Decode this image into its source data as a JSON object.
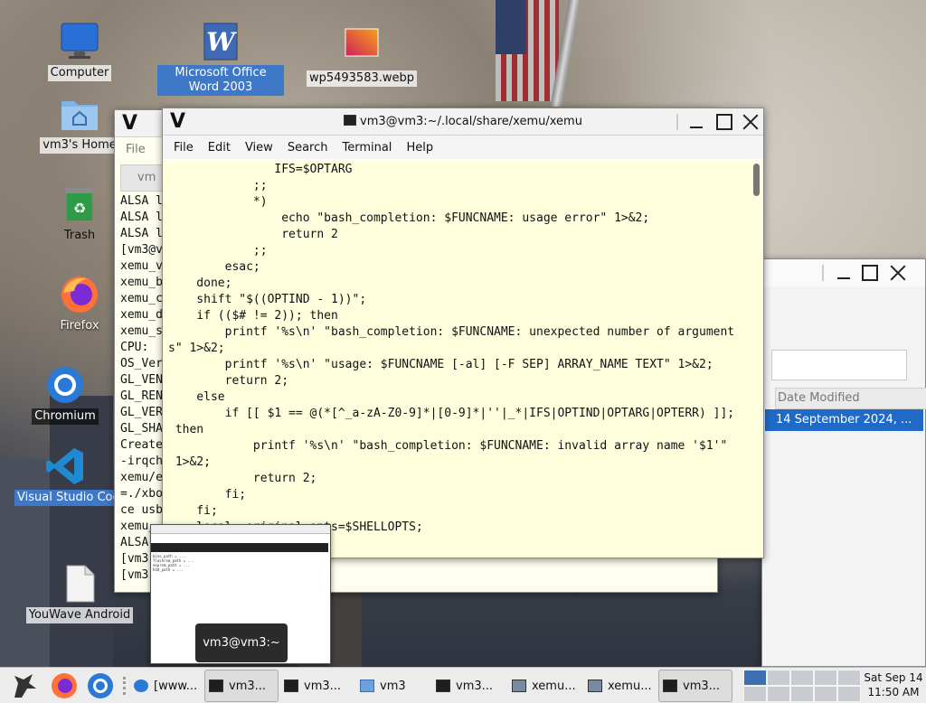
{
  "desktop_icons": {
    "computer": "Computer",
    "msword": "Microsoft Office Word 2003",
    "webp": "wp5493583.webp",
    "home": "vm3's Home",
    "trash": "Trash",
    "firefox": "Firefox",
    "chromium": "Chromium",
    "vscode": "Visual Studio Code",
    "youwave": "YouWave Android"
  },
  "terminal": {
    "title": "vm3@vm3:~/.local/share/xemu/xemu",
    "menu": [
      "File",
      "Edit",
      "View",
      "Search",
      "Terminal",
      "Help"
    ],
    "content": "               IFS=$OPTARG\n            ;;\n            *)\n                echo \"bash_completion: $FUNCNAME: usage error\" 1>&2;\n                return 2\n            ;;\n        esac;\n    done;\n    shift \"$((OPTIND - 1))\";\n    if (($# != 2)); then\n        printf '%s\\n' \"bash_completion: $FUNCNAME: unexpected number of argument\ns\" 1>&2;\n        printf '%s\\n' \"usage: $FUNCNAME [-al] [-F SEP] ARRAY_NAME TEXT\" 1>&2;\n        return 2;\n    else\n        if [[ $1 == @(*[^_a-zA-Z0-9]*|[0-9]*|''|_*|IFS|OPTIND|OPTARG|OPTERR) ]];\n then\n            printf '%s\\n' \"bash_completion: $FUNCNAME: invalid array name '$1'\"\n 1>&2;\n            return 2;\n        fi;\n    fi;\n    local _original_opts=$SHELLOPTS;"
  },
  "background_terminal": {
    "menu_file": "File",
    "tab_label": "vm",
    "content": "ALSA l\nALSA l\nALSA l\n[vm3@v\nxemu_v\nxemu_b\nxemu_c\nxemu_d\nxemu_s\nCPU:\nOS_Ver\nGL_VEN\nGL_REN\nGL_VER\nGL_SHA\nCreate\n-irqch\nxemu/e\n=./xbo\nce usb\nxemu_\nALSA\n[vm3\n[vm3"
  },
  "file_manager": {
    "column_date": "Date Modified",
    "row_date": "14 September 2024, ..."
  },
  "preview_tooltip": "vm3@vm3:~",
  "taskbar": {
    "items": [
      "[www...",
      "vm3...",
      "vm3...",
      "vm3",
      "vm3...",
      "xemu...",
      "xemu...",
      "vm3..."
    ],
    "clock_day": "Sat Sep 14",
    "clock_time": "11:50 AM"
  }
}
